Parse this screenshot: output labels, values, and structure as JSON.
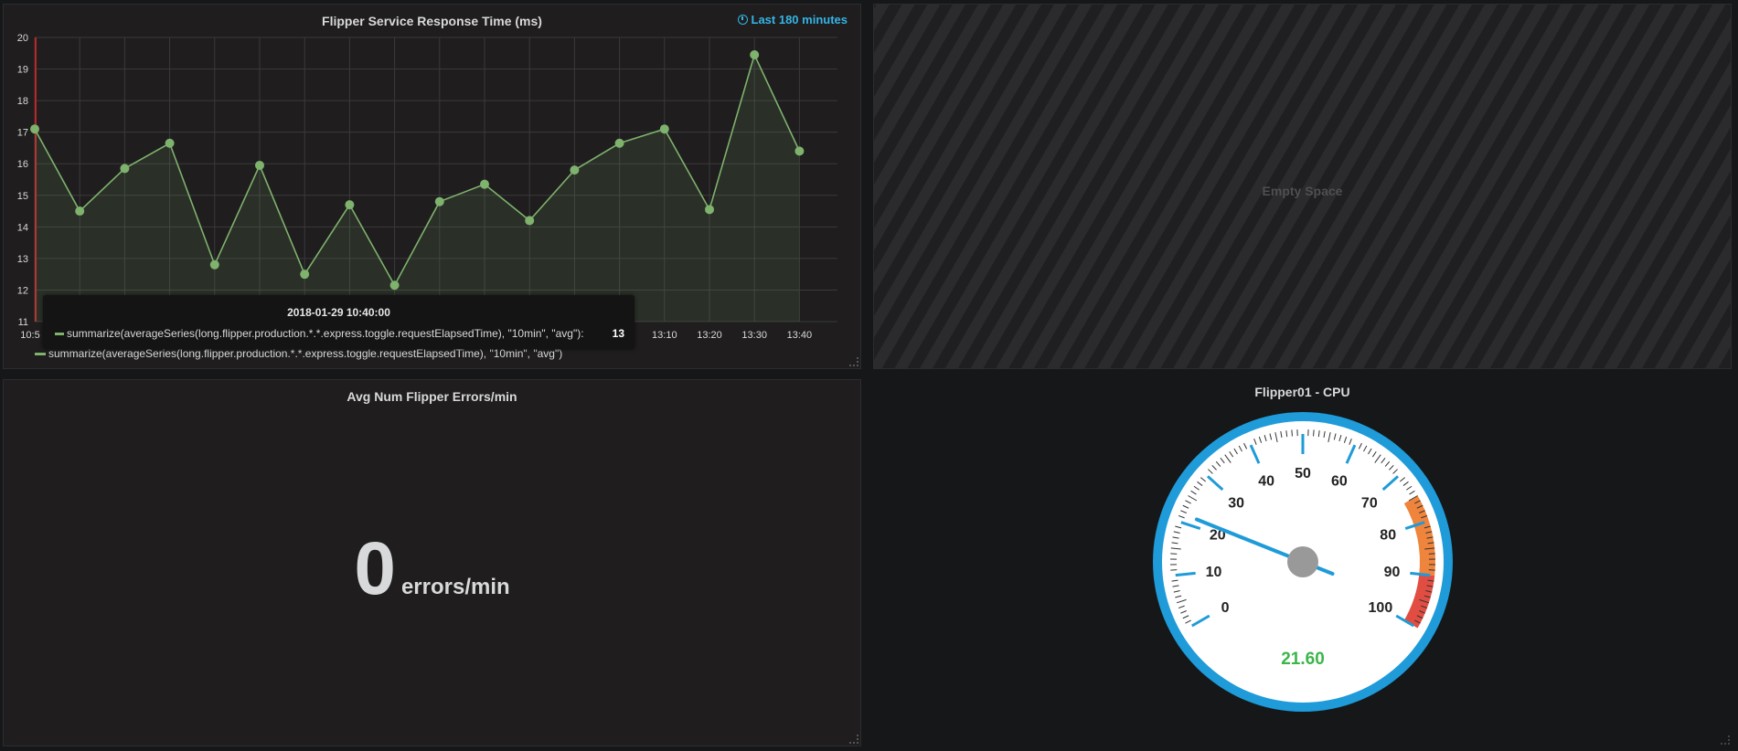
{
  "response_panel": {
    "title": "Flipper Service Response Time (ms)",
    "time_range": "Last 180 minutes",
    "legend_label": "summarize(averageSeries(long.flipper.production.*.*.express.toggle.requestElapsedTime), \"10min\", \"avg\")",
    "tooltip": {
      "time": "2018-01-29 10:40:00",
      "series": "summarize(averageSeries(long.flipper.production.*.*.express.toggle.requestElapsedTime), \"10min\", \"avg\"):",
      "value": "13"
    }
  },
  "chart_data": {
    "type": "line",
    "title": "Flipper Service Response Time (ms)",
    "x": [
      "10:50",
      "11:00",
      "11:10",
      "11:20",
      "11:30",
      "11:40",
      "11:50",
      "12:00",
      "12:10",
      "12:20",
      "12:30",
      "12:40",
      "12:50",
      "13:00",
      "13:10",
      "13:20",
      "13:30",
      "13:40"
    ],
    "x_tick_labels": [
      "10:5",
      "13:10",
      "13:20",
      "13:30",
      "13:40"
    ],
    "series": [
      {
        "name": "summarize(averageSeries(long.flipper.production.*.*.express.toggle.requestElapsedTime), \"10min\", \"avg\")",
        "color": "#7eb26d",
        "values": [
          17.1,
          14.5,
          15.85,
          16.65,
          12.8,
          15.95,
          12.5,
          14.7,
          12.15,
          14.8,
          15.35,
          14.2,
          15.8,
          16.65,
          17.1,
          14.55,
          19.45,
          16.4
        ]
      }
    ],
    "ylim": [
      11,
      20
    ],
    "y_ticks": [
      11,
      12,
      13,
      14,
      15,
      16,
      17,
      18,
      19,
      20
    ],
    "grid": true,
    "fill": true
  },
  "empty_panel": {
    "label": "Empty Space"
  },
  "errors_panel": {
    "title": "Avg Num Flipper Errors/min",
    "value": "0",
    "unit": "errors/min"
  },
  "cpu_panel": {
    "title": "Flipper01 - CPU",
    "value_text": "21.60",
    "value": 21.6,
    "scale_labels": [
      "0",
      "10",
      "20",
      "30",
      "40",
      "50",
      "60",
      "70",
      "80",
      "90",
      "100"
    ],
    "min": 0,
    "max": 100,
    "bands": [
      {
        "from": 75,
        "to": 90,
        "color": "#ef843c"
      },
      {
        "from": 90,
        "to": 100,
        "color": "#e24d42"
      }
    ],
    "colors": {
      "rim": "#1e9bd8",
      "needle": "#1e9bd8",
      "value": "#3cb54a"
    }
  }
}
